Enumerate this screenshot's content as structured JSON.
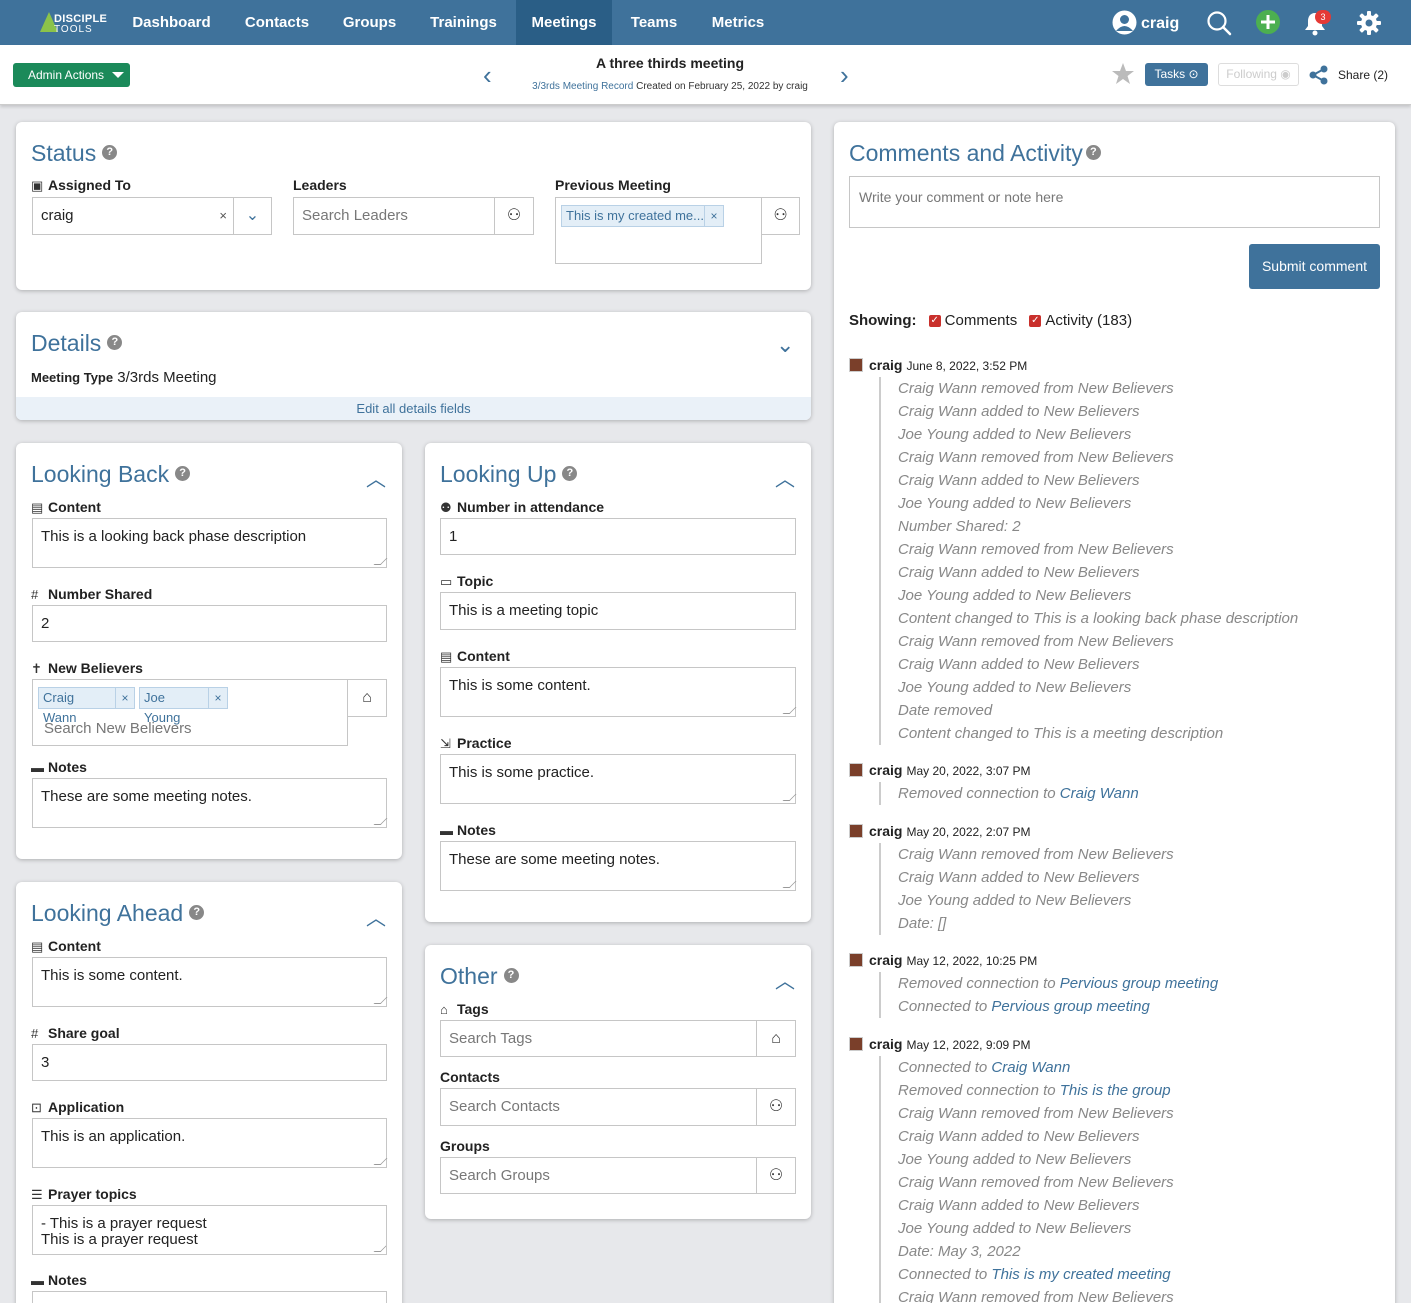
{
  "nav": {
    "logo_line1": "DISCIPLE",
    "logo_line2": "TOOLS",
    "items": [
      "Dashboard",
      "Contacts",
      "Groups",
      "Trainings",
      "Meetings",
      "Teams",
      "Metrics"
    ],
    "active": "Meetings",
    "user": "craig",
    "notification_count": "3",
    "accent_color": "#3f729b"
  },
  "subbar": {
    "admin_actions": "Admin Actions",
    "record_title": "A three thirds meeting",
    "record_type_link": "3/3rds Meeting Record",
    "record_meta": " Created on February 25, 2022 by craig",
    "tasks": "Tasks",
    "following": "Following",
    "share": "Share (2)"
  },
  "status": {
    "title": "Status",
    "assigned_to_label": "Assigned To",
    "assigned_to_value": "craig",
    "leaders_label": "Leaders",
    "leaders_placeholder": "Search Leaders",
    "previous_meeting_label": "Previous Meeting",
    "previous_meeting_chip": "This is my created me..."
  },
  "details": {
    "title": "Details",
    "meeting_type_label": "Meeting Type",
    "meeting_type_value": "3/3rds Meeting",
    "edit_all": "Edit all details fields"
  },
  "looking_back": {
    "title": "Looking Back",
    "content_label": "Content",
    "content_value": "This is a looking back phase description",
    "number_shared_label": "Number Shared",
    "number_shared_value": "2",
    "new_believers_label": "New Believers",
    "believers": [
      "Craig Wann",
      "Joe Young"
    ],
    "believers_placeholder": "Search New Believers",
    "notes_label": "Notes",
    "notes_value": "These are some meeting notes."
  },
  "looking_up": {
    "title": "Looking Up",
    "attendance_label": "Number in attendance",
    "attendance_value": "1",
    "topic_label": "Topic",
    "topic_value": "This is a meeting topic",
    "content_label": "Content",
    "content_value": "This is some content.",
    "practice_label": "Practice",
    "practice_value": "This is some practice.",
    "notes_label": "Notes",
    "notes_value": "These are some meeting notes."
  },
  "looking_ahead": {
    "title": "Looking Ahead",
    "content_label": "Content",
    "content_value": "This is some content.",
    "share_goal_label": "Share goal",
    "share_goal_value": "3",
    "application_label": "Application",
    "application_value": "This is an application.",
    "prayer_label": "Prayer topics",
    "prayer_line1": "- This is a prayer request",
    "prayer_line2": "This is a prayer request",
    "notes_label": "Notes"
  },
  "other": {
    "title": "Other",
    "tags_label": "Tags",
    "tags_placeholder": "Search Tags",
    "contacts_label": "Contacts",
    "contacts_placeholder": "Search Contacts",
    "groups_label": "Groups",
    "groups_placeholder": "Search Groups"
  },
  "comments": {
    "title": "Comments and Activity",
    "placeholder": "Write your comment or note here",
    "submit": "Submit comment",
    "showing_label": "Showing:",
    "filter_comments": "Comments",
    "filter_activity": "Activity (183)",
    "groups": [
      {
        "user": "craig",
        "time": "June 8, 2022, 3:52 PM",
        "lines": [
          "Craig Wann removed from New Believers",
          "Craig Wann added to New Believers",
          "Joe Young added to New Believers",
          "Craig Wann removed from New Believers",
          "Craig Wann added to New Believers",
          "Joe Young added to New Believers",
          "Number Shared: 2",
          "Craig Wann removed from New Believers",
          "Craig Wann added to New Believers",
          "Joe Young added to New Believers",
          "Content changed to This is a looking back phase description",
          "Craig Wann removed from New Believers",
          "Craig Wann added to New Believers",
          "Joe Young added to New Believers",
          "Date removed",
          "Content changed to This is a meeting description"
        ]
      },
      {
        "user": "craig",
        "time": "May 20, 2022, 3:07 PM",
        "lines": [
          {
            "text": "Removed connection to ",
            "link": "Craig Wann"
          }
        ]
      },
      {
        "user": "craig",
        "time": "May 20, 2022, 2:07 PM",
        "lines": [
          "Craig Wann removed from New Believers",
          "Craig Wann added to New Believers",
          "Joe Young added to New Believers",
          "Date: []"
        ]
      },
      {
        "user": "craig",
        "time": "May 12, 2022, 10:25 PM",
        "lines": [
          {
            "text": "Removed connection to ",
            "link": "Pervious group meeting"
          },
          {
            "text": "Connected to ",
            "link": "Pervious group meeting"
          }
        ]
      },
      {
        "user": "craig",
        "time": "May 12, 2022, 9:09 PM",
        "lines": [
          {
            "text": "Connected to ",
            "link": "Craig Wann"
          },
          {
            "text": "Removed connection to ",
            "link": "This is the group"
          },
          "Craig Wann removed from New Believers",
          "Craig Wann added to New Believers",
          "Joe Young added to New Believers",
          "Craig Wann removed from New Believers",
          "Craig Wann added to New Believers",
          "Joe Young added to New Believers",
          "Date: May 3, 2022",
          {
            "text": "Connected to ",
            "link": "This is my created meeting"
          },
          "Craig Wann removed from New Believers"
        ]
      }
    ]
  }
}
